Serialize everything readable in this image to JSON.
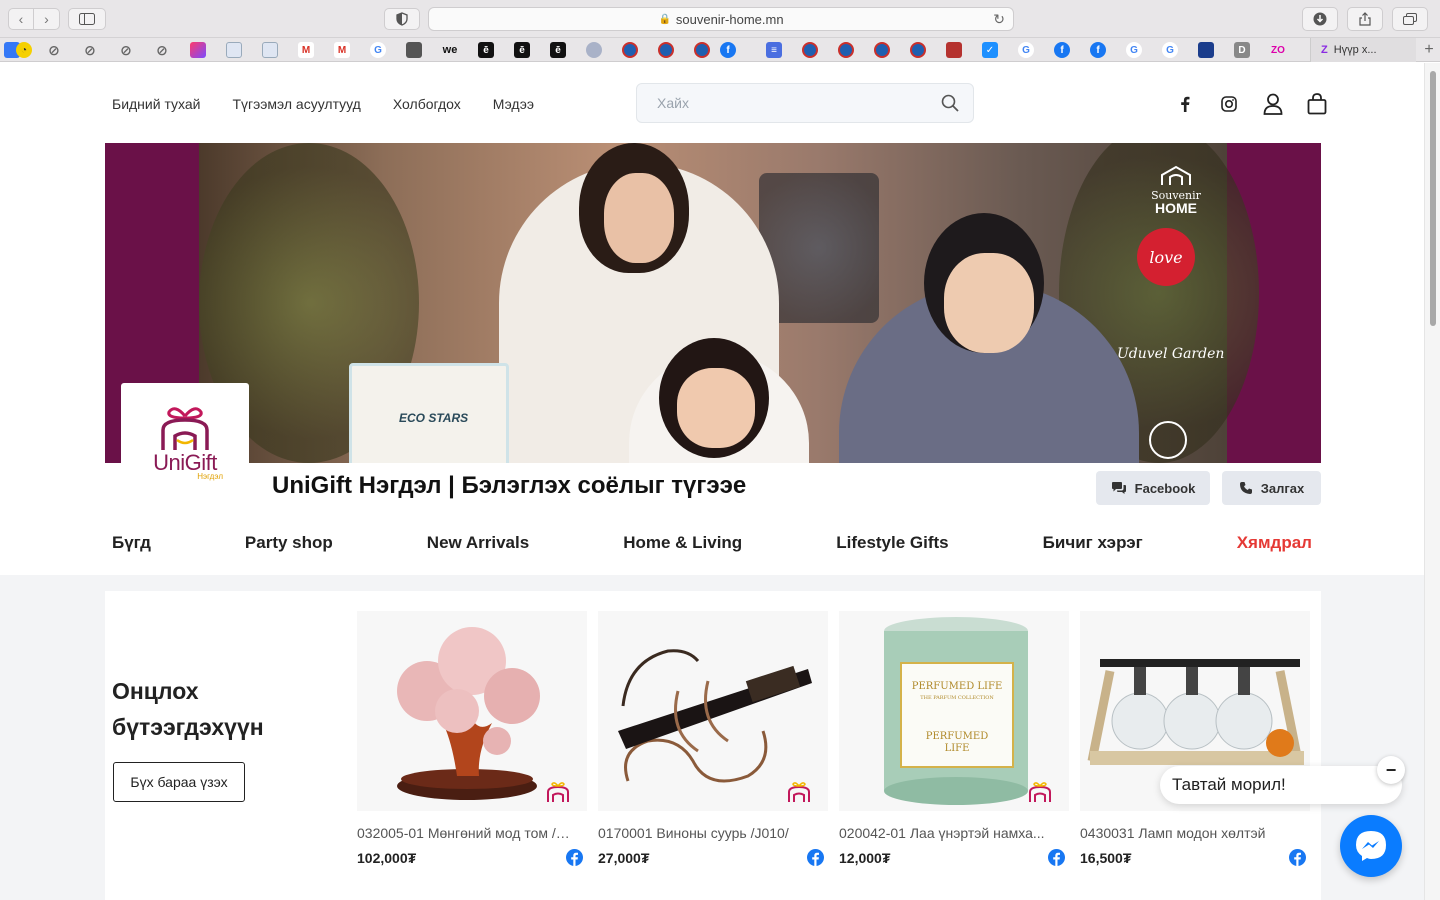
{
  "browser": {
    "url": "souvenir-home.mn",
    "active_tab_label": "Нүүр х...",
    "new_tab_glyph": "+"
  },
  "header": {
    "nav": [
      "Бидний тухай",
      "Түгээмэл асуултууд",
      "Холбогдох",
      "Мэдээ"
    ],
    "search_placeholder": "Хайх"
  },
  "banner": {
    "brand_top": "Souvenir",
    "brand_home": "HOME",
    "love_badge": "love",
    "garden": "Uduvel Garden",
    "gift_box_label": "ECO STARS"
  },
  "store": {
    "logo_text": "UniGift",
    "logo_sub": "Нэгдэл",
    "title": "UniGift Нэгдэл | Бэлэглэх соёлыг түгээе",
    "facebook_btn": "Facebook",
    "call_btn": "Залгах"
  },
  "categories": [
    "Бүгд",
    "Party shop",
    "New Arrivals",
    "Home & Living",
    "Lifestyle Gifts",
    "Бичиг хэрэг",
    "Хямдрал"
  ],
  "featured": {
    "title": "Онцлох бүтээгдэхүүн",
    "all_button": "Бүх бараа үзэх",
    "products": [
      {
        "name": "032005-01 Мөнгөний мод том /ч...",
        "price": "102,000₮"
      },
      {
        "name": "0170001 Виноны суурь /J010/",
        "price": "27,000₮"
      },
      {
        "name": "020042-01 Лаа үнэртэй намха...",
        "price": "12,000₮"
      },
      {
        "name": "0430031 Ламп модон хөлтэй",
        "price": "16,500₮"
      }
    ]
  },
  "chat": {
    "welcome": "Тавтай морил!",
    "close": "−"
  },
  "colors": {
    "banner_bg": "#6a1148",
    "sale": "#e53935",
    "messenger": "#0a7cff",
    "logo": "#8a1a55"
  }
}
